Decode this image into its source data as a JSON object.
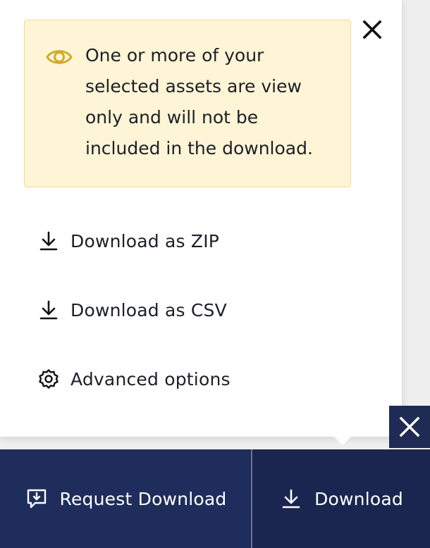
{
  "notice": {
    "icon": "eye-icon",
    "text": "One or more of your selected assets are view only and will not be included in the download.",
    "background": "#fdf5d6",
    "border_color": "#f0dc90",
    "icon_color": "#d4a82a"
  },
  "popover": {
    "close_icon": "close-icon",
    "menu": [
      {
        "label": "Download as ZIP",
        "icon": "download-icon"
      },
      {
        "label": "Download as CSV",
        "icon": "download-icon"
      },
      {
        "label": "Advanced options",
        "icon": "gear-icon"
      }
    ]
  },
  "bottom_bar": {
    "background": "#1f2d5c",
    "close_icon": "close-icon",
    "request_download": {
      "label": "Request Download",
      "icon": "request-download-icon"
    },
    "download": {
      "label": "Download",
      "icon": "download-icon"
    }
  }
}
